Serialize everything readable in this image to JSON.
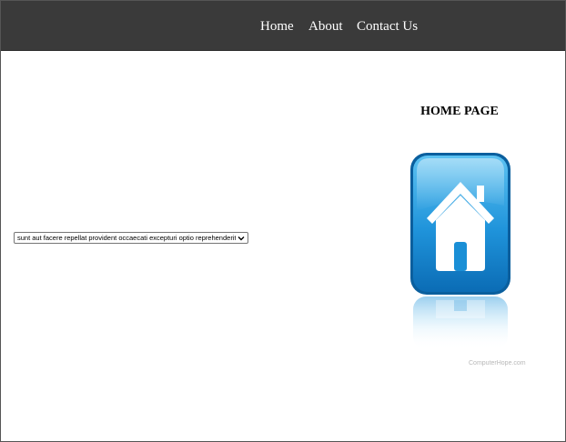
{
  "nav": {
    "items": [
      {
        "label": "Home"
      },
      {
        "label": "About"
      },
      {
        "label": "Contact Us"
      }
    ],
    "background_color": "#3a3a3a",
    "text_color": "#ffffff"
  },
  "main": {
    "heading": "HOME PAGE",
    "select": {
      "selected_value": "sunt aut facere repellat provident occaecati excepturi optio reprehenderit"
    },
    "image": {
      "icon": "house-icon",
      "icon_color": "#1a8fd6",
      "watermark": "ComputerHope.com"
    }
  }
}
